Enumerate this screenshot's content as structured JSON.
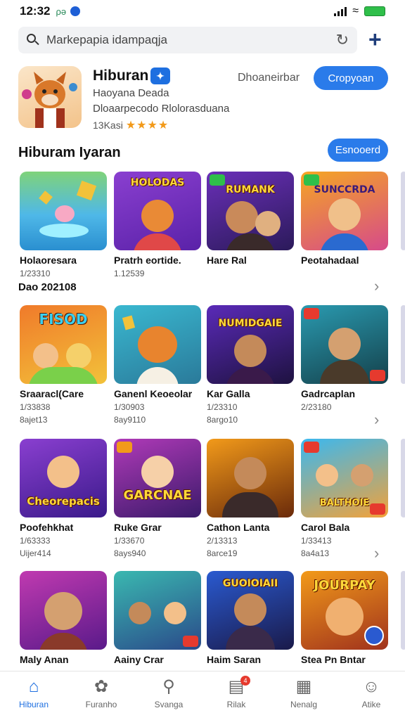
{
  "status_bar": {
    "time": "12:32",
    "extra": "ρə"
  },
  "search": {
    "placeholder": "Markeрapia idampaqja"
  },
  "featured": {
    "title": "Hiburan",
    "sub1": "Haoyana Deada",
    "sub2": "Dloaarpecodo Rlolorasduana",
    "meta": "13Kasi",
    "rating_stars": "★★★★",
    "aside": "Dhoaneirbar",
    "button": "Cropyoan"
  },
  "section": {
    "title": "Hiburam Iyaran",
    "button": "Esnooerd"
  },
  "rows": [
    {
      "sub": "Dao 202108",
      "cards": [
        {
          "title": "Holaoresara",
          "line1": "1/23310",
          "line2": ""
        },
        {
          "title": "Pratrh eortide.",
          "line1": "1.12539",
          "line2": ""
        },
        {
          "title": "Hare Ral",
          "line1": "",
          "line2": ""
        },
        {
          "title": "Peotahadaal",
          "line1": "",
          "line2": ""
        }
      ]
    },
    {
      "sub": "",
      "cards": [
        {
          "title": "Sraaracl(Care",
          "line1": "1/33838",
          "line2": "8ajet13"
        },
        {
          "title": "Ganenl Keoeolar",
          "line1": "1/30903",
          "line2": "8ay9110"
        },
        {
          "title": "Kar Galla",
          "line1": "1/23310",
          "line2": "8argo10"
        },
        {
          "title": "Gadrcaplan",
          "line1": "2/23180",
          "line2": ""
        }
      ]
    },
    {
      "sub": "",
      "cards": [
        {
          "title": "Poofehkhat",
          "line1": "1/63333",
          "line2": "Uijer414"
        },
        {
          "title": "Ruke Grar",
          "line1": "1/33670",
          "line2": "8ays940"
        },
        {
          "title": "Cathon Lanta",
          "line1": "2/13313",
          "line2": "8arce19"
        },
        {
          "title": "Carol Bala",
          "line1": "1/33413",
          "line2": "8a4a13"
        }
      ]
    },
    {
      "sub": "",
      "cards": [
        {
          "title": "Maly Anan",
          "line1": "",
          "line2": ""
        },
        {
          "title": "Aainy Crar",
          "line1": "",
          "line2": ""
        },
        {
          "title": "Haim Saran",
          "line1": "",
          "line2": ""
        },
        {
          "title": "Stea Pn Bntar",
          "line1": "",
          "line2": ""
        }
      ]
    }
  ],
  "thumb_text": {
    "r0c1": "HOLODAS",
    "r0c2": "RUMANK",
    "r0c3": "SUNCCRDA",
    "r1c0": "FISOD",
    "r1c2": "NUMIDGAIE",
    "r2c0": "Cheorepacis",
    "r2c1": "GARCNAE",
    "r2c3": "BALTHOIE",
    "r3c2": "GUOIOIAII",
    "r3c3": "JOURPAY"
  },
  "nav": [
    {
      "label": "Hiburan",
      "icon": "home-icon",
      "active": true
    },
    {
      "label": "Furanho",
      "icon": "palette-icon",
      "active": false
    },
    {
      "label": "Svanga",
      "icon": "search-icon",
      "active": false
    },
    {
      "label": "Rilak",
      "icon": "news-icon",
      "active": false,
      "badge": "4"
    },
    {
      "label": "Nenalg",
      "icon": "calendar-icon",
      "active": false
    },
    {
      "label": "Atike",
      "icon": "profile-icon",
      "active": false
    }
  ],
  "colors": {
    "accent": "#2a7bea",
    "star": "#f29a1a",
    "badge": "#e63a2e"
  }
}
